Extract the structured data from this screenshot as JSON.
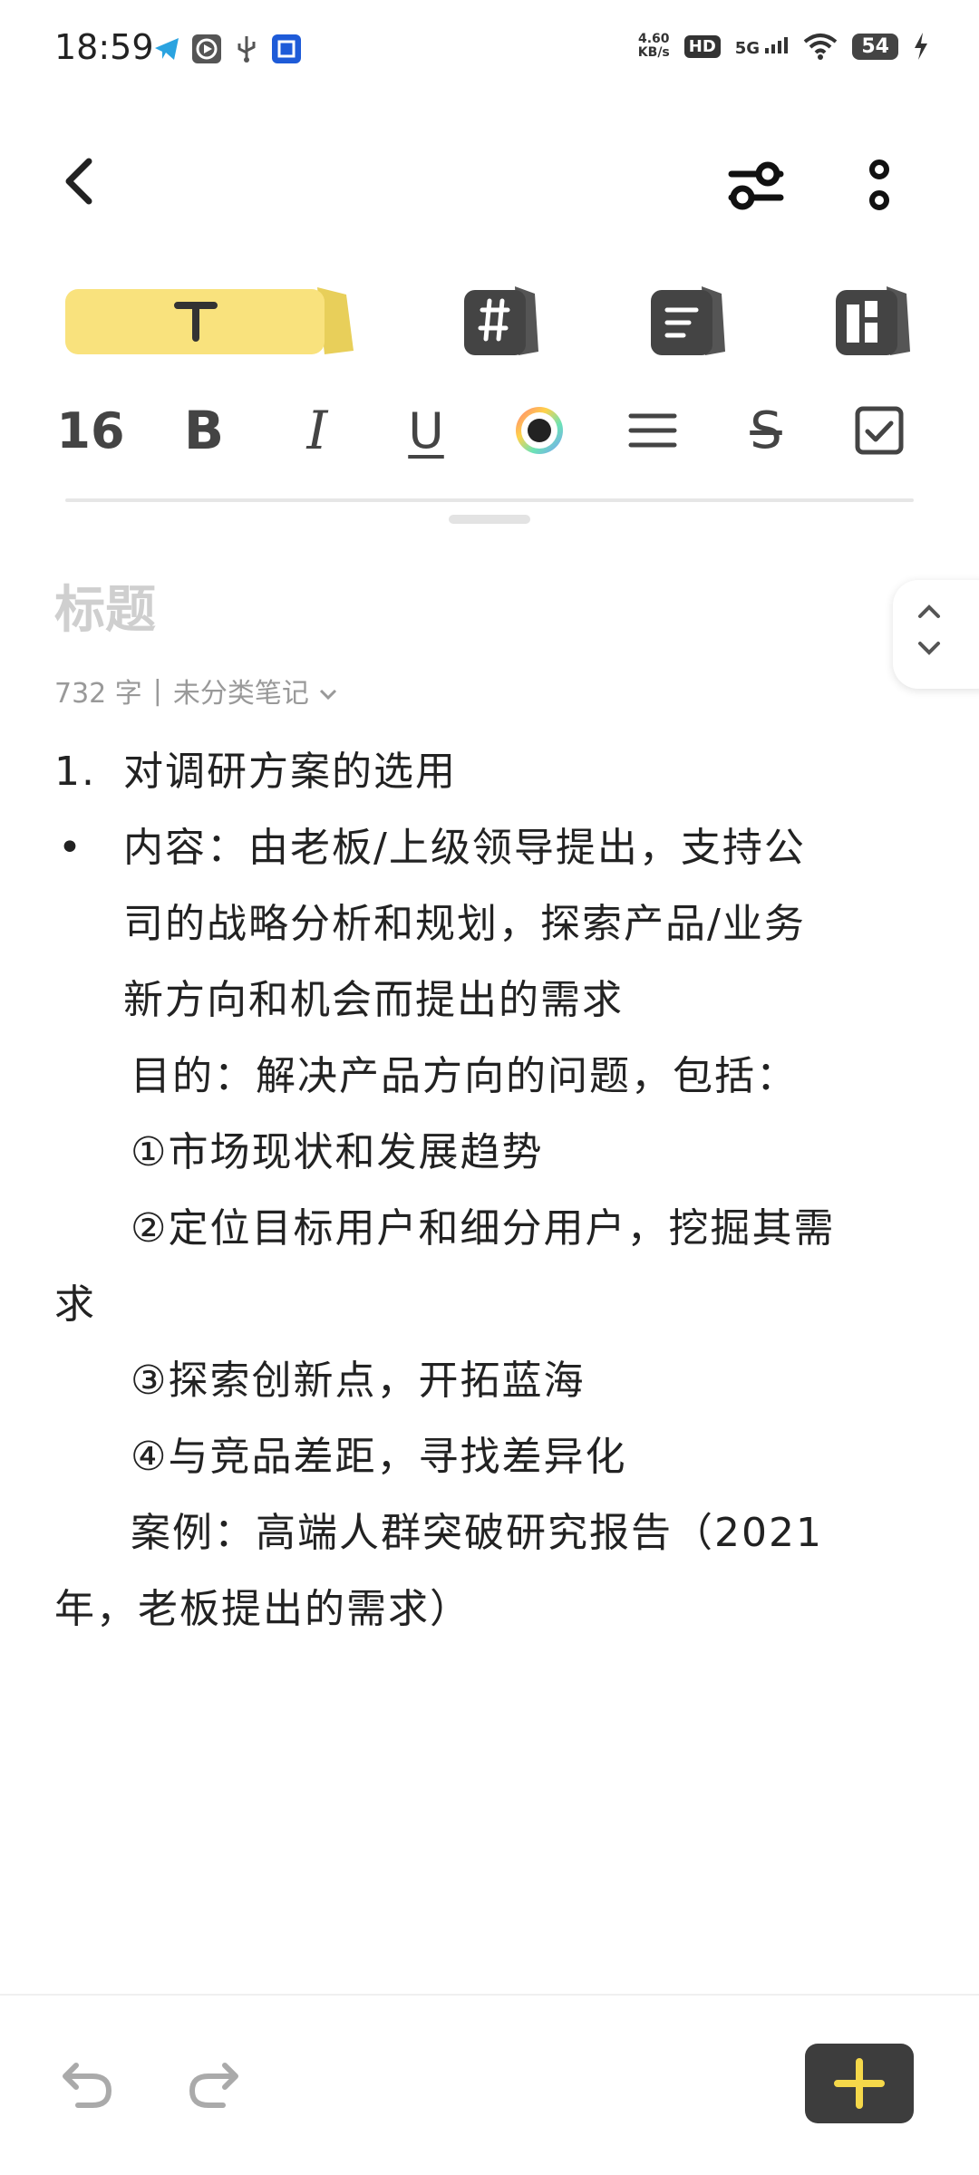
{
  "status_bar": {
    "time": "18:59",
    "speed_value": "4.60",
    "speed_unit": "KB/s",
    "hd": "HD",
    "network": "5G",
    "battery": "54",
    "notification_icons": [
      "telegram-icon",
      "media-icon",
      "usb-icon",
      "app-icon"
    ]
  },
  "toolbar": {
    "mode_tabs": [
      "text-mode-icon",
      "tag-icon",
      "list-icon",
      "grid-icon"
    ],
    "font_size": "16",
    "bold": "B",
    "italic": "I",
    "underline": "U",
    "strike": "S",
    "accent_color": "#F9E27D"
  },
  "note": {
    "title_placeholder": "标题",
    "word_count": "732 字",
    "separator": "|",
    "category": "未分类笔记",
    "lines": [
      "1.",
      "对调研方案的选用",
      "•",
      "内容：由老板/上级领导提出，支持公",
      "司的战略分析和规划，探索产品/业务",
      "新方向和机会而提出的需求",
      "目的：解决产品方向的问题，包括：",
      "①市场现状和发展趋势",
      "②定位目标用户和细分用户，挖掘其需",
      "求",
      "③探索创新点，开拓蓝海",
      "④与竞品差距，寻找差异化",
      "案例：高端人群突破研究报告（2021",
      "年，老板提出的需求）"
    ]
  },
  "bottom": {
    "add_icon": "plus-icon",
    "add_color": "#F5D84A"
  }
}
